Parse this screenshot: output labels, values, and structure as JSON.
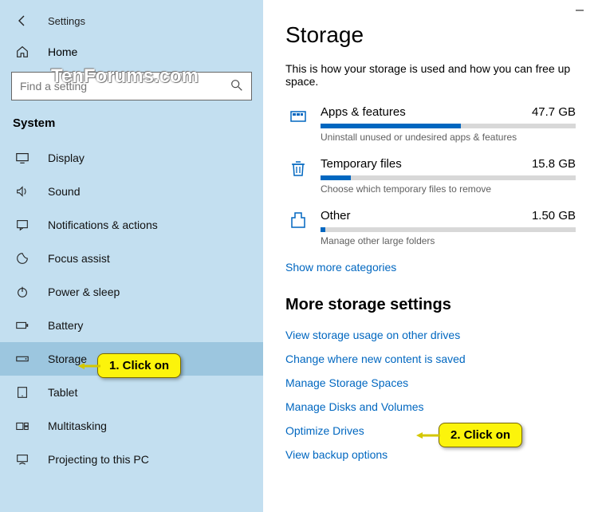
{
  "window": {
    "title": "Settings"
  },
  "watermark": "TenForums.com",
  "sidebar": {
    "home": "Home",
    "search_placeholder": "Find a setting",
    "category": "System",
    "items": [
      {
        "label": "Display"
      },
      {
        "label": "Sound"
      },
      {
        "label": "Notifications & actions"
      },
      {
        "label": "Focus assist"
      },
      {
        "label": "Power & sleep"
      },
      {
        "label": "Battery"
      },
      {
        "label": "Storage"
      },
      {
        "label": "Tablet"
      },
      {
        "label": "Multitasking"
      },
      {
        "label": "Projecting to this PC"
      }
    ]
  },
  "page": {
    "title": "Storage",
    "description": "This is how your storage is used and how you can free up space.",
    "storage_items": [
      {
        "label": "Apps & features",
        "size": "47.7 GB",
        "fill_pct": 55,
        "sub": "Uninstall unused or undesired apps & features"
      },
      {
        "label": "Temporary files",
        "size": "15.8 GB",
        "fill_pct": 12,
        "sub": "Choose which temporary files to remove"
      },
      {
        "label": "Other",
        "size": "1.50 GB",
        "fill_pct": 2,
        "sub": "Manage other large folders"
      }
    ],
    "show_more": "Show more categories",
    "more_title": "More storage settings",
    "links": [
      "View storage usage on other drives",
      "Change where new content is saved",
      "Manage Storage Spaces",
      "Manage Disks and Volumes",
      "Optimize Drives",
      "View backup options"
    ]
  },
  "callouts": {
    "one": "1. Click on",
    "two": "2. Click on"
  }
}
